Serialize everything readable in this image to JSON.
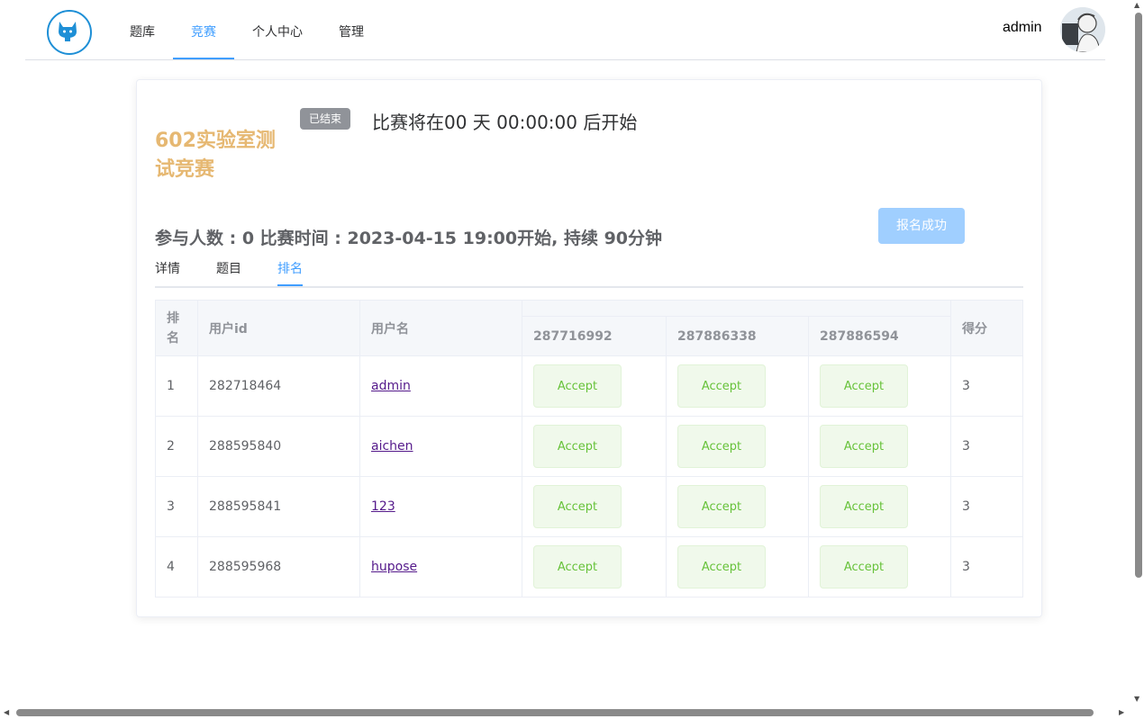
{
  "header": {
    "nav": [
      "题库",
      "竞赛",
      "个人中心",
      "管理"
    ],
    "user_name": "admin"
  },
  "contest": {
    "title": "602实验室测试竞赛",
    "status": "已结束",
    "countdown": "比赛将在00 天 00:00:00 后开始",
    "meta": "参与人数 : 0 比赛时间 : 2023-04-15 19:00开始, 持续 90分钟",
    "signup_label": "报名成功",
    "tabs": [
      "详情",
      "题目",
      "排名"
    ]
  },
  "ranking": {
    "headers": {
      "rank": "排名",
      "user_id": "用户id",
      "username": "用户名",
      "score": "得分"
    },
    "problems": [
      "287716992",
      "287886338",
      "287886594"
    ],
    "rows": [
      {
        "rank": "1",
        "user_id": "282718464",
        "username": "admin",
        "results": [
          "Accept",
          "Accept",
          "Accept"
        ],
        "score": "3"
      },
      {
        "rank": "2",
        "user_id": "288595840",
        "username": "aichen",
        "results": [
          "Accept",
          "Accept",
          "Accept"
        ],
        "score": "3"
      },
      {
        "rank": "3",
        "user_id": "288595841",
        "username": "123",
        "results": [
          "Accept",
          "Accept",
          "Accept"
        ],
        "score": "3"
      },
      {
        "rank": "4",
        "user_id": "288595968",
        "username": "hupose",
        "results": [
          "Accept",
          "Accept",
          "Accept"
        ],
        "score": "3"
      }
    ]
  },
  "icons": {
    "logo": "github-cat-icon",
    "avatar": "user-avatar"
  },
  "colors": {
    "accent": "#409eff",
    "title": "#e6b872",
    "accept_text": "#67c23a",
    "status_tag": "#909399"
  }
}
